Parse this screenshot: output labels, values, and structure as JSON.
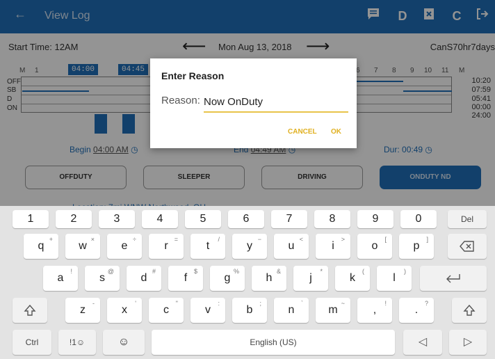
{
  "topbar": {
    "back_icon": "arrow-left-icon",
    "title": "View Log",
    "icons": [
      "message-icon",
      "D",
      "edit-doc-icon",
      "refresh-icon",
      "logout-icon"
    ],
    "d_label": "D"
  },
  "log": {
    "start_time": "Start Time: 12AM",
    "date": "Mon Aug 13, 2018",
    "cycle": "CanS70hr7days",
    "hours": [
      "M",
      "1",
      "2",
      "6",
      "7",
      "8",
      "9",
      "10",
      "11",
      "M"
    ],
    "statuses": [
      "OFF",
      "SB",
      "D",
      "ON"
    ],
    "totals": [
      "10:20",
      "07:59",
      "05:41",
      "00:00",
      "24:00"
    ],
    "tag_start": "04:00",
    "tag_end": "04:45",
    "begin_label": "Begin",
    "begin_value": "04:00 AM",
    "end_label": "End",
    "end_value": "04:49 AM",
    "dur_label": "Dur:",
    "dur_value": "00:49",
    "status_buttons": [
      "OFFDUTY",
      "SLEEPER",
      "DRIVING",
      "ONDUTY ND"
    ],
    "location": "Location: 7mi WNW Northwood, OH"
  },
  "dialog": {
    "title": "Enter Reason",
    "reason_label": "Reason:",
    "reason_value": "Now OnDuty",
    "cancel": "CANCEL",
    "ok": "OK"
  },
  "keyboard": {
    "row1": [
      "1",
      "2",
      "3",
      "4",
      "5",
      "6",
      "7",
      "8",
      "9",
      "0",
      "Del"
    ],
    "row2": [
      "q",
      "w",
      "e",
      "r",
      "t",
      "y",
      "u",
      "i",
      "o",
      "p"
    ],
    "row2_sub": [
      "+",
      "×",
      "÷",
      "=",
      "/",
      "−",
      "<",
      ">",
      "[",
      "]"
    ],
    "row3": [
      "a",
      "s",
      "d",
      "f",
      "g",
      "h",
      "j",
      "k",
      "l"
    ],
    "row3_sub": [
      "!",
      "@",
      "#",
      "$",
      "%",
      "&",
      "*",
      "(",
      ")"
    ],
    "row4": [
      "z",
      "x",
      "c",
      "v",
      "b",
      "n",
      "m",
      ",",
      "."
    ],
    "row4_sub": [
      "-",
      "'",
      "\"",
      ":",
      ";",
      "`",
      "~",
      "!",
      "?"
    ],
    "ctrl": "Ctrl",
    "symbols": "!1☺",
    "space": "English (US)"
  },
  "colors": {
    "accent": "#1f6fb8",
    "dialog_button": "#e0b020"
  }
}
